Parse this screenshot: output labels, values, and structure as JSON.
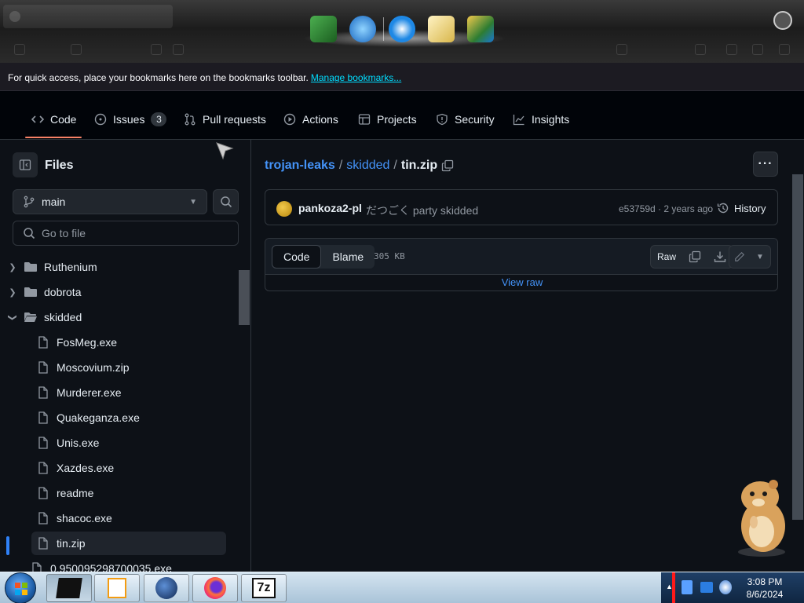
{
  "browser": {
    "bookmarks_text": "For quick access, place your bookmarks here on the bookmarks toolbar.",
    "manage_bookmarks": "Manage bookmarks..."
  },
  "repo_nav": {
    "code": "Code",
    "issues": "Issues",
    "issues_count": "3",
    "pull_requests": "Pull requests",
    "actions": "Actions",
    "projects": "Projects",
    "security": "Security",
    "insights": "Insights"
  },
  "sidebar": {
    "title": "Files",
    "branch": "main",
    "goto_placeholder": "Go to file",
    "tree": [
      {
        "label": "Ruthenium",
        "type": "folder",
        "expanded": false
      },
      {
        "label": "dobrota",
        "type": "folder",
        "expanded": false
      },
      {
        "label": "skidded",
        "type": "folder",
        "expanded": true
      },
      {
        "label": "FosMeg.exe",
        "type": "file"
      },
      {
        "label": "Moscovium.zip",
        "type": "file"
      },
      {
        "label": "Murderer.exe",
        "type": "file"
      },
      {
        "label": "Quakeganza.exe",
        "type": "file"
      },
      {
        "label": "Unis.exe",
        "type": "file"
      },
      {
        "label": "Xazdes.exe",
        "type": "file"
      },
      {
        "label": "readme",
        "type": "file"
      },
      {
        "label": "shacoc.exe",
        "type": "file"
      },
      {
        "label": "tin.zip",
        "type": "file",
        "selected": true
      },
      {
        "label": "0.950095298700035.exe",
        "type": "file"
      }
    ]
  },
  "breadcrumb": {
    "repo": "trojan-leaks",
    "sep1": "/",
    "folder": "skidded",
    "sep2": "/",
    "file": "tin.zip"
  },
  "commit": {
    "author": "pankoza2-pl",
    "message": "だつごく party skidded",
    "meta": "e53759d · 2 years ago",
    "history": "History"
  },
  "file_view": {
    "code_tab": "Code",
    "blame_tab": "Blame",
    "size": "305 KB",
    "raw": "Raw",
    "view_raw": "View raw"
  },
  "taskbar": {
    "time": "3:08 PM",
    "date": "8/6/2024"
  },
  "colors": {
    "accent_link": "#4493f8",
    "active_tab_underline": "#f78166",
    "background": "#0d1117"
  }
}
